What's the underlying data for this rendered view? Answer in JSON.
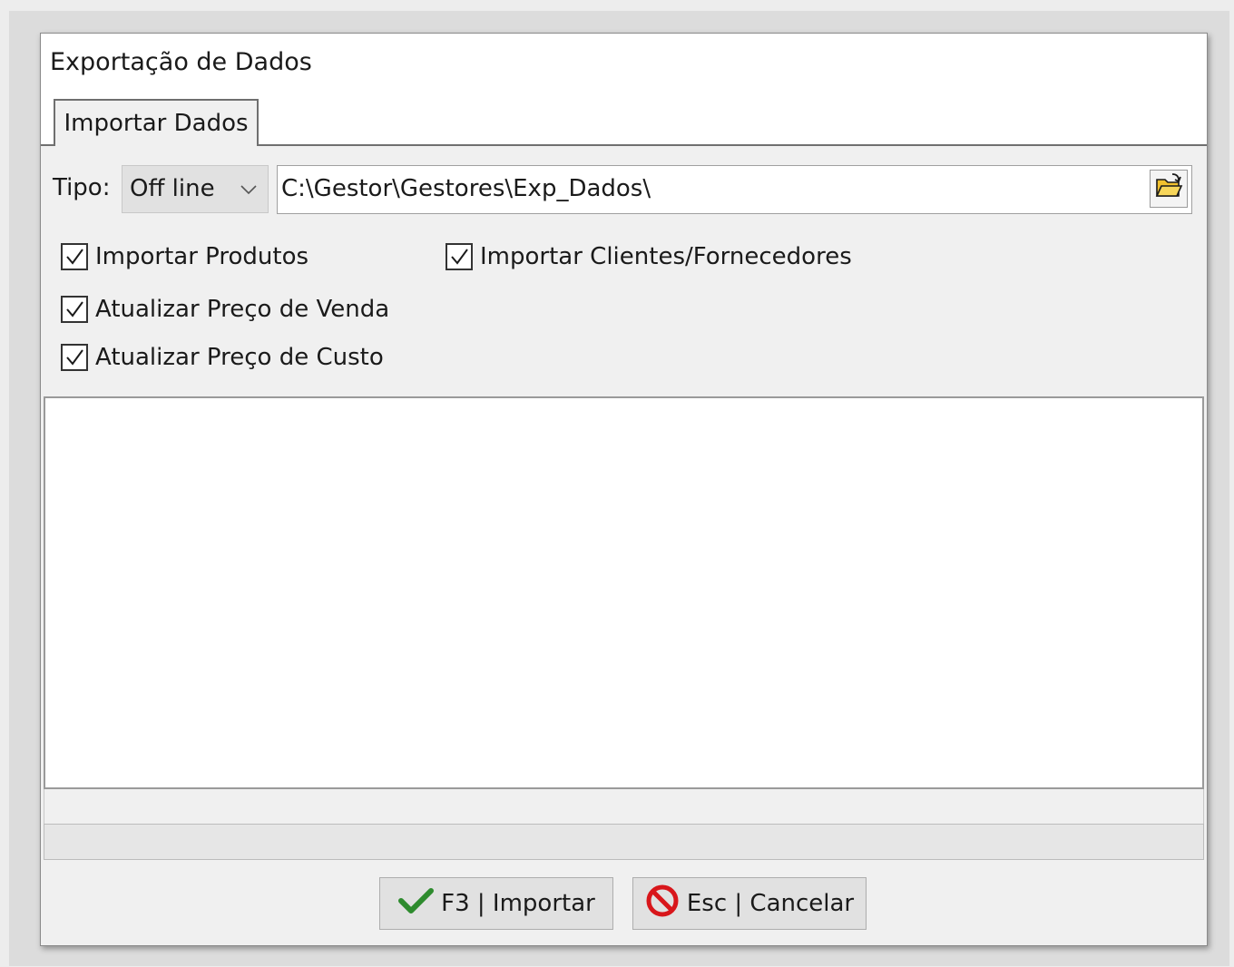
{
  "window": {
    "title": "Exportação de Dados"
  },
  "tabs": [
    {
      "label": "Importar Dados",
      "active": true
    }
  ],
  "tipo": {
    "label": "Tipo:",
    "selected": "Off line"
  },
  "path": {
    "value": "C:\\Gestor\\Gestores\\Exp_Dados\\"
  },
  "checkboxes": {
    "importar_produtos": {
      "label": "Importar Produtos",
      "checked": true
    },
    "importar_clientes": {
      "label": "Importar Clientes/Fornecedores",
      "checked": true
    },
    "atualizar_venda": {
      "label": "Atualizar Preço de Venda",
      "checked": true
    },
    "atualizar_custo": {
      "label": "Atualizar Preço de Custo",
      "checked": true
    }
  },
  "progress": {
    "value": 0
  },
  "buttons": {
    "import_label": "F3 | Importar",
    "cancel_label": "Esc | Cancelar"
  },
  "colors": {
    "import_check": "#2e8b2e",
    "cancel_icon": "#d8161b",
    "progress_fill": "#06b025"
  }
}
